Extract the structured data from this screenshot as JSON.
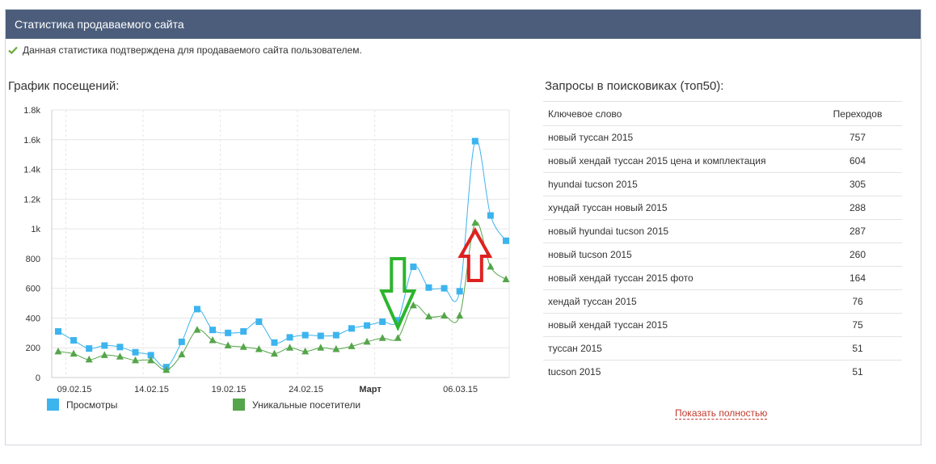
{
  "header": {
    "title": "Статистика продаваемого сайта"
  },
  "notice": {
    "text": "Данная статистика подтверждена для продаваемого сайта пользователем."
  },
  "chart": {
    "title": "График посещений:"
  },
  "legend": {
    "views": "Просмотры",
    "unique": "Уникальные посетители"
  },
  "colors": {
    "views": "#3cb4ee",
    "unique": "#55a54a",
    "header": "#4b5d7b",
    "arrow_up": "#e02020",
    "arrow_down": "#2db52d"
  },
  "chart_data": {
    "type": "line",
    "title": "",
    "xlabel": "",
    "ylabel": "",
    "ylim": [
      0,
      1800
    ],
    "yticks": [
      0,
      200,
      400,
      600,
      800,
      1000,
      1200,
      1400,
      1600,
      1800
    ],
    "ytick_labels": [
      "0",
      "200",
      "400",
      "600",
      "800",
      "1k",
      "1.2k",
      "1.4k",
      "1.6k",
      "1.8k"
    ],
    "xtick_labels": [
      {
        "index": 0,
        "label": "09.02.15",
        "bold": false
      },
      {
        "index": 5,
        "label": "14.02.15",
        "bold": false
      },
      {
        "index": 10,
        "label": "19.02.15",
        "bold": false
      },
      {
        "index": 15,
        "label": "24.02.15",
        "bold": false
      },
      {
        "index": 20,
        "label": "Март",
        "bold": true
      },
      {
        "index": 25,
        "label": "06.03.15",
        "bold": false
      }
    ],
    "x": [
      "09.02.15",
      "10.02.15",
      "11.02.15",
      "12.02.15",
      "13.02.15",
      "14.02.15",
      "15.02.15",
      "16.02.15",
      "17.02.15",
      "18.02.15",
      "19.02.15",
      "20.02.15",
      "21.02.15",
      "22.02.15",
      "23.02.15",
      "24.02.15",
      "25.02.15",
      "26.02.15",
      "27.02.15",
      "28.02.15",
      "01.03.15",
      "02.03.15",
      "03.03.15",
      "04.03.15",
      "05.03.15",
      "06.03.15",
      "07.03.15",
      "08.03.15",
      "09.03.15",
      "10.03.15"
    ],
    "grid": true,
    "legend_position": "bottom",
    "series": [
      {
        "name": "Просмотры",
        "marker": "square",
        "values": [
          310,
          250,
          195,
          215,
          205,
          170,
          150,
          70,
          240,
          460,
          320,
          300,
          310,
          375,
          235,
          270,
          285,
          280,
          285,
          330,
          350,
          375,
          385,
          745,
          605,
          600,
          580,
          1590,
          1090,
          920
        ]
      },
      {
        "name": "Уникальные посетители",
        "marker": "triangle",
        "values": [
          175,
          160,
          120,
          150,
          140,
          115,
          115,
          50,
          155,
          320,
          250,
          215,
          205,
          190,
          160,
          200,
          175,
          200,
          190,
          210,
          240,
          265,
          265,
          485,
          410,
          415,
          415,
          1040,
          745,
          660
        ]
      }
    ]
  },
  "arrows": [
    {
      "direction": "down",
      "color_key": "arrow_down",
      "index": 22
    },
    {
      "direction": "up",
      "color_key": "arrow_up",
      "index": 27
    }
  ],
  "keywords": {
    "title": "Запросы в поисковиках (топ50):",
    "col_keyword": "Ключевое слово",
    "col_visits": "Переходов",
    "rows": [
      {
        "keyword": "новый туссан 2015",
        "visits": "757"
      },
      {
        "keyword": "новый хендай туссан 2015 цена и комплектация",
        "visits": "604"
      },
      {
        "keyword": "hyundai tucson 2015",
        "visits": "305"
      },
      {
        "keyword": "хундай туссан новый 2015",
        "visits": "288"
      },
      {
        "keyword": "новый hyundai tucson 2015",
        "visits": "287"
      },
      {
        "keyword": "новый tucson 2015",
        "visits": "260"
      },
      {
        "keyword": "новый хендай туссан 2015 фото",
        "visits": "164"
      },
      {
        "keyword": "хендай туссан 2015",
        "visits": "76"
      },
      {
        "keyword": "новый хендай туссан 2015",
        "visits": "75"
      },
      {
        "keyword": "туссан 2015",
        "visits": "51"
      },
      {
        "keyword": "tucson 2015",
        "visits": "51"
      }
    ],
    "show_all": "Показать полностью"
  }
}
